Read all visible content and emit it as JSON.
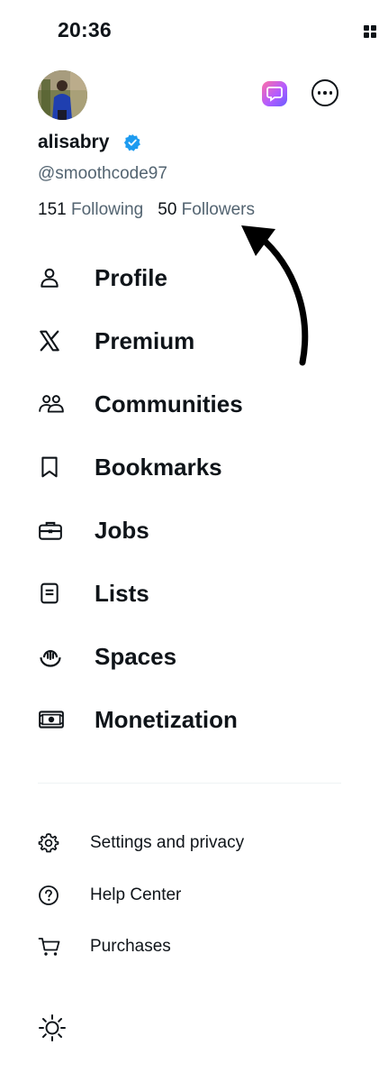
{
  "status_bar": {
    "time": "20:36"
  },
  "profile": {
    "display_name": "alisabry",
    "handle": "@smoothcode97",
    "following_count": "151",
    "following_label": "Following",
    "followers_count": "50",
    "followers_label": "Followers",
    "verified": true
  },
  "nav": {
    "items": [
      {
        "label": "Profile",
        "icon": "person-icon"
      },
      {
        "label": "Premium",
        "icon": "x-logo-icon"
      },
      {
        "label": "Communities",
        "icon": "communities-icon"
      },
      {
        "label": "Bookmarks",
        "icon": "bookmark-icon"
      },
      {
        "label": "Jobs",
        "icon": "briefcase-icon"
      },
      {
        "label": "Lists",
        "icon": "list-icon"
      },
      {
        "label": "Spaces",
        "icon": "spaces-icon"
      },
      {
        "label": "Monetization",
        "icon": "money-icon"
      }
    ]
  },
  "secondary": {
    "items": [
      {
        "label": "Settings and privacy",
        "icon": "gear-icon"
      },
      {
        "label": "Help Center",
        "icon": "help-icon"
      },
      {
        "label": "Purchases",
        "icon": "cart-icon"
      }
    ]
  },
  "colors": {
    "text_primary": "#0f1419",
    "text_secondary": "#536471",
    "verified_blue": "#1d9bf0",
    "divider": "#eff3f4"
  }
}
